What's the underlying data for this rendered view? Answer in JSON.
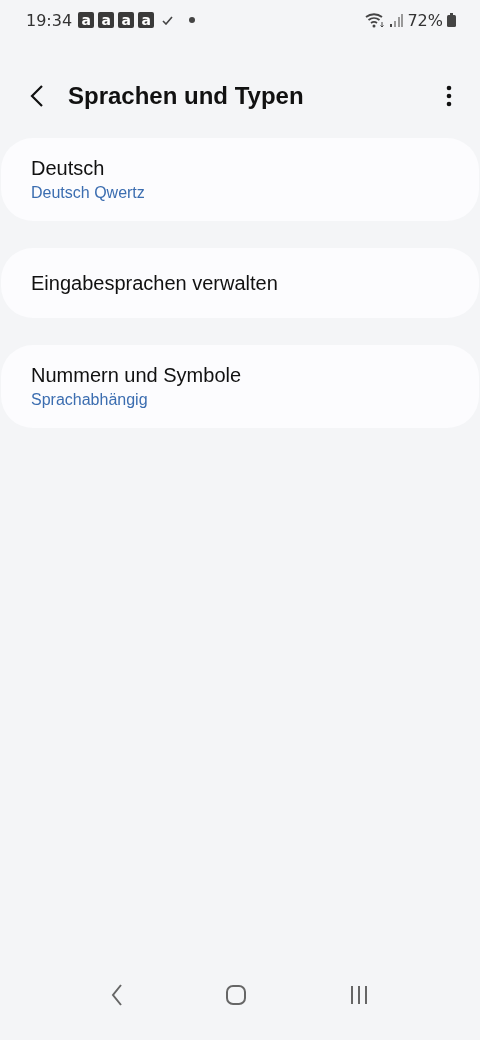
{
  "status_bar": {
    "time": "19:34",
    "notification_letters": [
      "a",
      "a",
      "a",
      "a"
    ],
    "battery_text": "72%"
  },
  "header": {
    "title": "Sprachen und Typen"
  },
  "items": [
    {
      "title": "Deutsch",
      "subtitle": "Deutsch Qwertz"
    },
    {
      "title": "Eingabesprachen verwalten"
    },
    {
      "title": "Nummern und Symbole",
      "subtitle": "Sprachabhängig"
    }
  ]
}
